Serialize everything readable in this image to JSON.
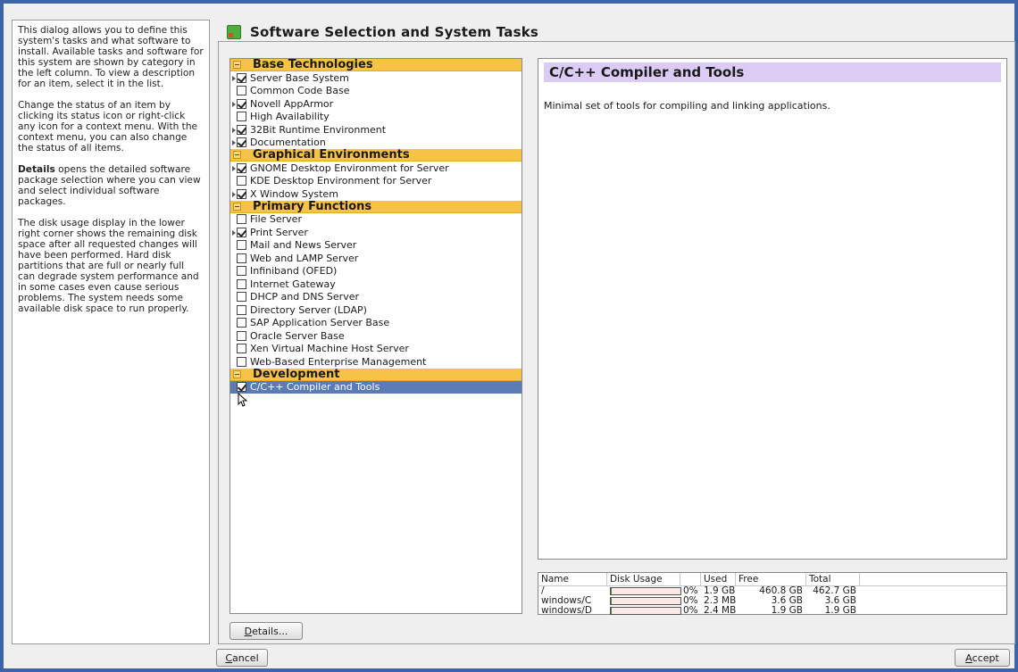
{
  "help": {
    "p1": "This dialog allows you to define this system's tasks and what software to install. Available tasks and software for this system are shown by category in the left column. To view a description for an item, select it in the list.",
    "p2": "Change the status of an item by clicking its status icon or right-click any icon for a context menu. With the context menu, you can also change the status of all items.",
    "p3_bold": "Details",
    "p3_rest": " opens the detailed software package selection where you can view and select individual software packages.",
    "p4": "The disk usage display in the lower right corner shows the remaining disk space after all requested changes will have been performed. Hard disk partitions that are full or nearly full can degrade system performance and in some cases even cause serious problems. The system needs some available disk space to run properly."
  },
  "header": {
    "title": "Software Selection and System Tasks"
  },
  "categories": [
    {
      "label": "Base Technologies",
      "items": [
        {
          "label": "Server Base System",
          "checked": true,
          "auto": true
        },
        {
          "label": "Common Code Base",
          "checked": false,
          "auto": false
        },
        {
          "label": "Novell AppArmor",
          "checked": true,
          "auto": true
        },
        {
          "label": "High Availability",
          "checked": false,
          "auto": false
        },
        {
          "label": "32Bit Runtime Environment",
          "checked": true,
          "auto": true
        },
        {
          "label": "Documentation",
          "checked": true,
          "auto": true
        }
      ]
    },
    {
      "label": "Graphical Environments",
      "items": [
        {
          "label": "GNOME Desktop Environment for Server",
          "checked": true,
          "auto": true
        },
        {
          "label": "KDE Desktop Environment for Server",
          "checked": false,
          "auto": false
        },
        {
          "label": "X Window System",
          "checked": true,
          "auto": true
        }
      ]
    },
    {
      "label": "Primary Functions",
      "items": [
        {
          "label": "File Server",
          "checked": false,
          "auto": false
        },
        {
          "label": "Print Server",
          "checked": true,
          "auto": true
        },
        {
          "label": "Mail and News Server",
          "checked": false,
          "auto": false
        },
        {
          "label": "Web and LAMP Server",
          "checked": false,
          "auto": false
        },
        {
          "label": "Infiniband (OFED)",
          "checked": false,
          "auto": false
        },
        {
          "label": "Internet Gateway",
          "checked": false,
          "auto": false
        },
        {
          "label": "DHCP and DNS Server",
          "checked": false,
          "auto": false
        },
        {
          "label": "Directory Server (LDAP)",
          "checked": false,
          "auto": false
        },
        {
          "label": "SAP Application Server Base",
          "checked": false,
          "auto": false
        },
        {
          "label": "Oracle Server Base",
          "checked": false,
          "auto": false
        },
        {
          "label": "Xen Virtual Machine Host Server",
          "checked": false,
          "auto": false
        },
        {
          "label": "Web-Based Enterprise Management",
          "checked": false,
          "auto": false
        }
      ]
    },
    {
      "label": "Development",
      "items": [
        {
          "label": "C/C++ Compiler and Tools",
          "checked": true,
          "auto": false,
          "selected": true
        }
      ]
    }
  ],
  "description": {
    "title": "C/C++ Compiler and Tools",
    "text": "Minimal set of tools for compiling and linking applications."
  },
  "disk": {
    "headers": [
      "Name",
      "Disk Usage",
      "",
      "Used",
      "Free",
      "Total"
    ],
    "rows": [
      {
        "name": "/",
        "percent": "0%",
        "fraction": 0.0,
        "used": "1.9 GB",
        "free": "460.8 GB",
        "total": "462.7 GB"
      },
      {
        "name": "windows/C",
        "percent": "0%",
        "fraction": 0.0,
        "used": "2.3 MB",
        "free": "3.6 GB",
        "total": "3.6 GB"
      },
      {
        "name": "windows/D",
        "percent": "0%",
        "fraction": 0.0,
        "used": "2.4 MB",
        "free": "1.9 GB",
        "total": "1.9 GB"
      }
    ]
  },
  "buttons": {
    "details_u": "D",
    "details_rest": "etails...",
    "cancel_u": "C",
    "cancel_rest": "ancel",
    "accept_u": "A",
    "accept_rest": "ccept"
  }
}
